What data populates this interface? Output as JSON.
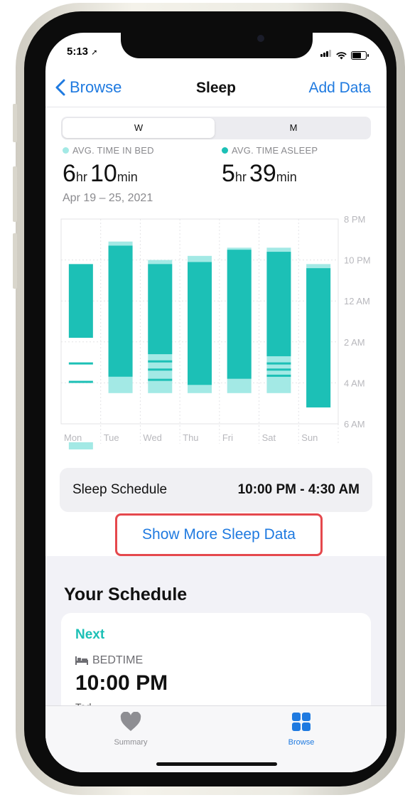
{
  "status_bar": {
    "time": "5:13"
  },
  "nav": {
    "back_label": "Browse",
    "title": "Sleep",
    "action_label": "Add Data"
  },
  "segmented": {
    "options": [
      "W",
      "M"
    ],
    "selected": "W"
  },
  "stats": {
    "in_bed": {
      "label": "AVG. TIME IN BED",
      "hours": "6",
      "hours_unit": "hr",
      "minutes": "10",
      "minutes_unit": "min",
      "color": "#a3e9e5"
    },
    "asleep": {
      "label": "AVG. TIME ASLEEP",
      "hours": "5",
      "hours_unit": "hr",
      "minutes": "39",
      "minutes_unit": "min",
      "color": "#1cc0b6"
    }
  },
  "date_range": "Apr 19 – 25, 2021",
  "colors": {
    "asleep": "#1cc0b6",
    "in_bed": "#a3e9e5",
    "accent_blue": "#1f7ae0",
    "highlight_red": "#e5484d"
  },
  "chart_data": {
    "type": "bar",
    "subtype": "floating-range",
    "y_axis_labels": [
      "8 PM",
      "10 PM",
      "12 AM",
      "2 AM",
      "4 AM",
      "6 AM"
    ],
    "y_axis_hours_from_8pm": [
      0,
      2,
      4,
      6,
      8,
      10
    ],
    "categories": [
      "Mon",
      "Tue",
      "Wed",
      "Thu",
      "Fri",
      "Sat",
      "Sun"
    ],
    "in_bed": [
      [
        [
          10.9,
          15.0
        ],
        [
          16.1,
          16.5
        ]
      ],
      [
        [
          1.1,
          8.5
        ]
      ],
      [
        [
          2.0,
          8.5
        ]
      ],
      [
        [
          1.8,
          8.5
        ]
      ],
      [
        [
          1.4,
          8.5
        ]
      ],
      [
        [
          1.4,
          8.5
        ]
      ],
      [
        [
          2.2,
          9.2
        ]
      ]
    ],
    "asleep": [
      [
        [
          2.2,
          5.8
        ],
        [
          7.0,
          7.1
        ],
        [
          7.9,
          8.0
        ]
      ],
      [
        [
          1.3,
          7.7
        ]
      ],
      [
        [
          2.2,
          6.6
        ],
        [
          6.9,
          7.0
        ],
        [
          7.3,
          7.4
        ],
        [
          7.8,
          7.9
        ]
      ],
      [
        [
          2.1,
          8.1
        ]
      ],
      [
        [
          1.5,
          7.8
        ]
      ],
      [
        [
          1.6,
          6.7
        ],
        [
          7.0,
          7.1
        ],
        [
          7.3,
          7.4
        ],
        [
          7.6,
          7.7
        ]
      ],
      [
        [
          2.4,
          9.2
        ]
      ]
    ],
    "grid": true,
    "legend": "none"
  },
  "schedule_card": {
    "label": "Sleep Schedule",
    "value": "10:00 PM - 4:30 AM"
  },
  "show_more_label": "Show More Sleep Data",
  "your_schedule": {
    "title": "Your Schedule",
    "next_label": "Next",
    "bedtime_label": "BEDTIME",
    "bedtime_value": "10:00 PM",
    "truncated_text": "Tod"
  },
  "tabbar": {
    "items": [
      {
        "label": "Summary",
        "icon": "heart-icon"
      },
      {
        "label": "Browse",
        "icon": "grid-icon"
      }
    ]
  }
}
